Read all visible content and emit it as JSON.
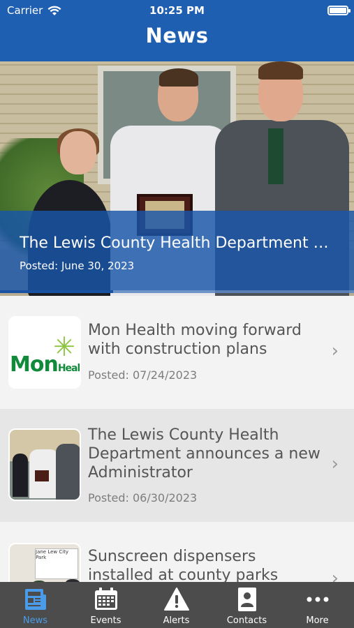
{
  "status_bar": {
    "carrier": "Carrier",
    "time": "10:25 PM"
  },
  "nav": {
    "title": "News"
  },
  "hero": {
    "title": "The Lewis County Health Department announces a new Administrator",
    "date": "Posted: June 30, 2023",
    "progress": 0.32
  },
  "articles": [
    {
      "title": "Mon Health moving forward with construction plans",
      "date": "Posted: 07/24/2023",
      "thumbnail": "mon-health-logo",
      "logo_text": "Mon",
      "logo_small": "Heal"
    },
    {
      "title": "The Lewis County Health Department announces a new Administrator",
      "date": "Posted: 06/30/2023",
      "thumbnail": "award-photo"
    },
    {
      "title": "Sunscreen dispensers installed at county parks",
      "date": "",
      "thumbnail": "park-photo",
      "sign_text": "Jane Lew City Park"
    }
  ],
  "tabs": [
    {
      "label": "News",
      "icon": "newspaper-icon",
      "active": true
    },
    {
      "label": "Events",
      "icon": "calendar-icon",
      "active": false
    },
    {
      "label": "Alerts",
      "icon": "warning-icon",
      "active": false
    },
    {
      "label": "Contacts",
      "icon": "contact-card-icon",
      "active": false
    },
    {
      "label": "More",
      "icon": "more-dots-icon",
      "active": false
    }
  ],
  "colors": {
    "nav_blue": "#1f5fb2",
    "tab_active": "#4a9be8",
    "tabbar_bg": "#4c4c4c"
  }
}
